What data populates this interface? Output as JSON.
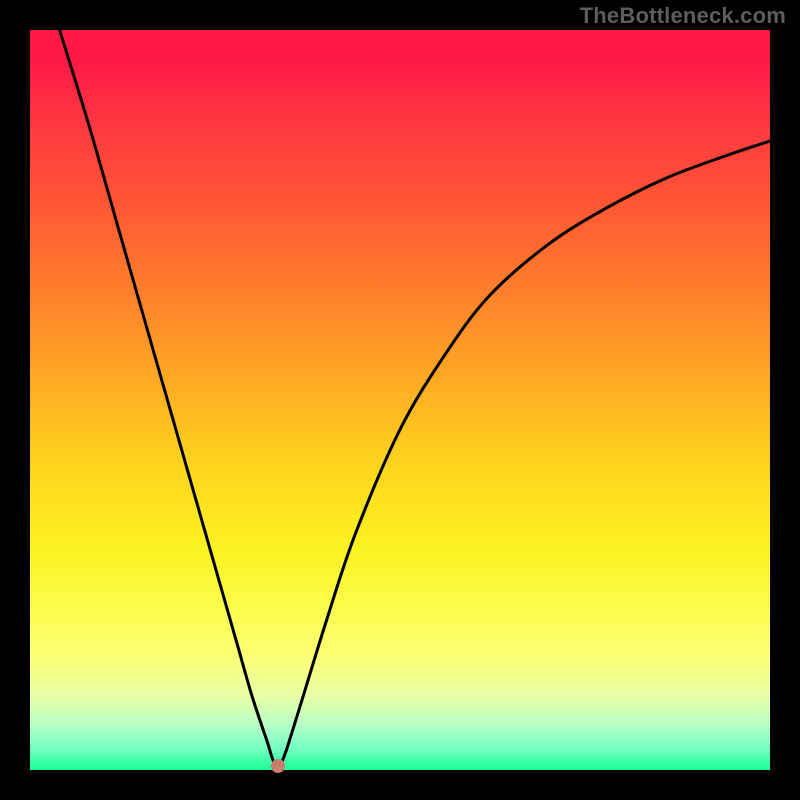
{
  "watermark": "TheBottleneck.com",
  "chart_data": {
    "type": "line",
    "title": "",
    "xlabel": "",
    "ylabel": "",
    "xlim": [
      0,
      100
    ],
    "ylim": [
      0,
      100
    ],
    "grid": false,
    "legend": false,
    "series": [
      {
        "name": "curve",
        "color": "#000000",
        "x": [
          4,
          8,
          12,
          16,
          20,
          22,
          24,
          26,
          28,
          30,
          32,
          33,
          34,
          36,
          40,
          44,
          50,
          56,
          62,
          70,
          78,
          86,
          94,
          100
        ],
        "y": [
          100,
          87,
          73,
          59,
          45,
          38,
          31,
          24,
          17,
          10,
          4,
          1,
          1,
          7,
          20,
          32,
          46,
          56,
          64,
          71,
          76,
          80,
          83,
          85
        ]
      }
    ],
    "marker": {
      "name": "dot",
      "x": 33.5,
      "y": 0.5,
      "color": "#c97d6d"
    }
  }
}
